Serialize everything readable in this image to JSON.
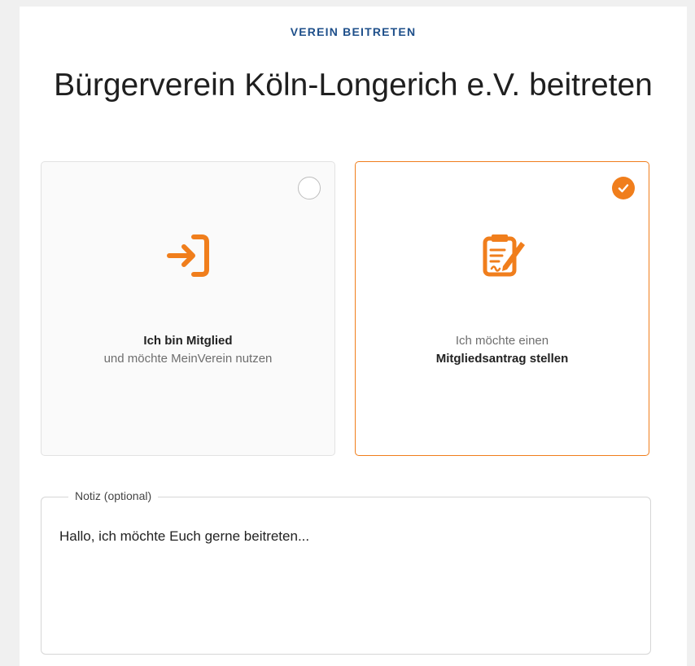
{
  "header": {
    "kicker": "VEREIN BEITRETEN",
    "title": "Bürgerverein Köln-Longerich e.V. beitreten"
  },
  "options": [
    {
      "icon": "login-arrow-icon",
      "line1": "Ich bin Mitglied",
      "line2": "und möchte MeinVerein nutzen",
      "selected": false
    },
    {
      "icon": "application-form-icon",
      "line1": "Ich möchte einen",
      "line2": "Mitgliedsantrag stellen",
      "selected": true
    }
  ],
  "note": {
    "label": "Notiz (optional)",
    "value": "Hallo, ich möchte Euch gerne beitreten..."
  },
  "colors": {
    "accent": "#f07e1c",
    "kicker": "#1e4f8a"
  }
}
